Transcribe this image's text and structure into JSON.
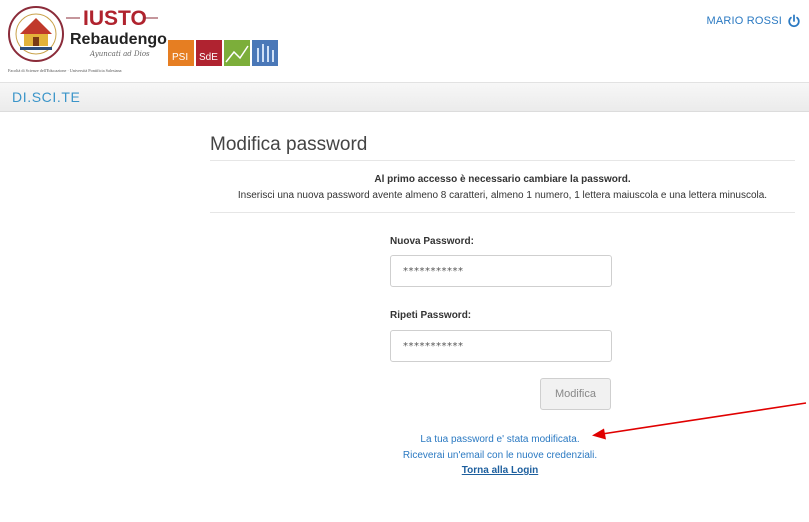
{
  "header": {
    "logo": {
      "brand_name": "IUSTO",
      "brand_subname": "Rebaudengo",
      "motto": "Ayuncati ad Dios",
      "caption": "Facoltà di Scienze dell'Educazione · Università Pontificia Salesiana",
      "seal_text": "Istituto Universitario Salesiano Torino Rebaudengo",
      "badges": [
        "PSI",
        "SdE"
      ]
    },
    "user": {
      "name": "MARIO ROSSI",
      "icon": "power-icon"
    }
  },
  "navbar": {
    "brand": "DI.SCI.TE"
  },
  "main": {
    "title": "Modifica password",
    "notice": {
      "bold": "Al primo accesso è necessario cambiare la password.",
      "text": "Inserisci una nuova password avente almeno 8 caratteri, almeno 1 numero, 1 lettera maiuscola e una lettera minuscola."
    },
    "fields": {
      "new_password": {
        "label": "Nuova Password:",
        "value": "***********"
      },
      "repeat_password": {
        "label": "Ripeti Password:",
        "value": "***********"
      }
    },
    "submit_label": "Modifica",
    "result": {
      "line1": "La tua password e' stata modificata.",
      "line2": "Riceverai un'email con le nuove credenziali.",
      "link": "Torna alla Login"
    }
  },
  "colors": {
    "accent": "#2a79c2",
    "brand": "#3b95c9",
    "annotation": "#e00000"
  }
}
